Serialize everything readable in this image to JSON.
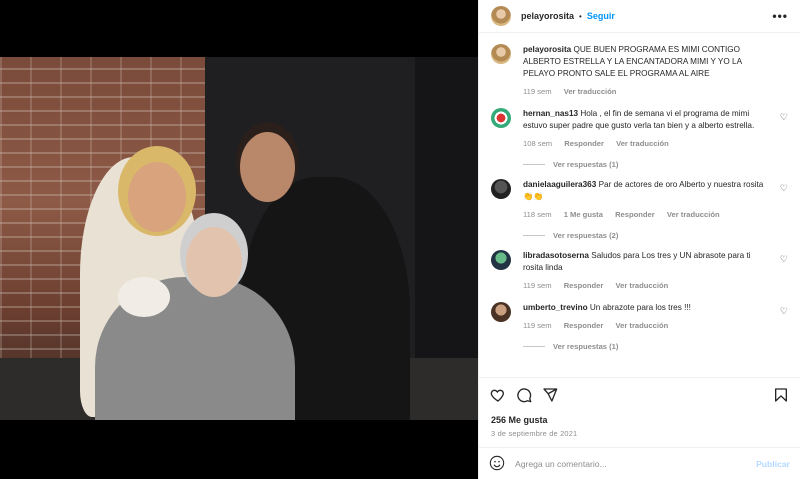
{
  "post": {
    "username": "pelayorosita",
    "follow_label": "Seguir",
    "separator": "•",
    "more_label": "•••"
  },
  "caption": {
    "username": "pelayorosita",
    "text": "QUE BUEN PROGRAMA ES MIMI CONTIGO ALBERTO ESTRELLA Y LA ENCANTADORA MIMI Y YO LA PELAYO PRONTO SALE EL PROGRAMA AL AIRE",
    "age": "119 sem",
    "translate": "Ver traducción"
  },
  "comments": [
    {
      "username": "hernan_nas13",
      "text": "Hola , el fin de semana vi el programa de mimi estuvo super padre que gusto verla tan bien y a alberto estrella.",
      "age": "108 sem",
      "reply": "Responder",
      "translate": "Ver traducción",
      "replies": "Ver respuestas (1)"
    },
    {
      "username": "danielaaguilera363",
      "text": "Par de actores de oro Alberto y nuestra rosita👏👏",
      "age": "118 sem",
      "likes": "1 Me gusta",
      "reply": "Responder",
      "translate": "Ver traducción",
      "replies": "Ver respuestas (2)"
    },
    {
      "username": "libradasotoserna",
      "text": "Saludos para Los tres y UN abrasote para ti rosita linda",
      "age": "119 sem",
      "reply": "Responder",
      "translate": "Ver traducción"
    },
    {
      "username": "umberto_trevino",
      "text": "Un abrazote para los tres !!!",
      "age": "119 sem",
      "reply": "Responder",
      "translate": "Ver traducción",
      "replies": "Ver respuestas (1)"
    }
  ],
  "footer": {
    "likes": "256 Me gusta",
    "date": "3 de septiembre de 2021",
    "comment_placeholder": "Agrega un comentario...",
    "publish_label": "Publicar"
  },
  "icons": {
    "heart": "heart-icon",
    "comment": "comment-icon",
    "share": "share-icon",
    "save": "bookmark-icon",
    "emoji": "emoji-icon"
  },
  "colors": {
    "link": "#0095f6",
    "muted": "#8e8e8e",
    "publish_disabled": "#b3dbff"
  }
}
